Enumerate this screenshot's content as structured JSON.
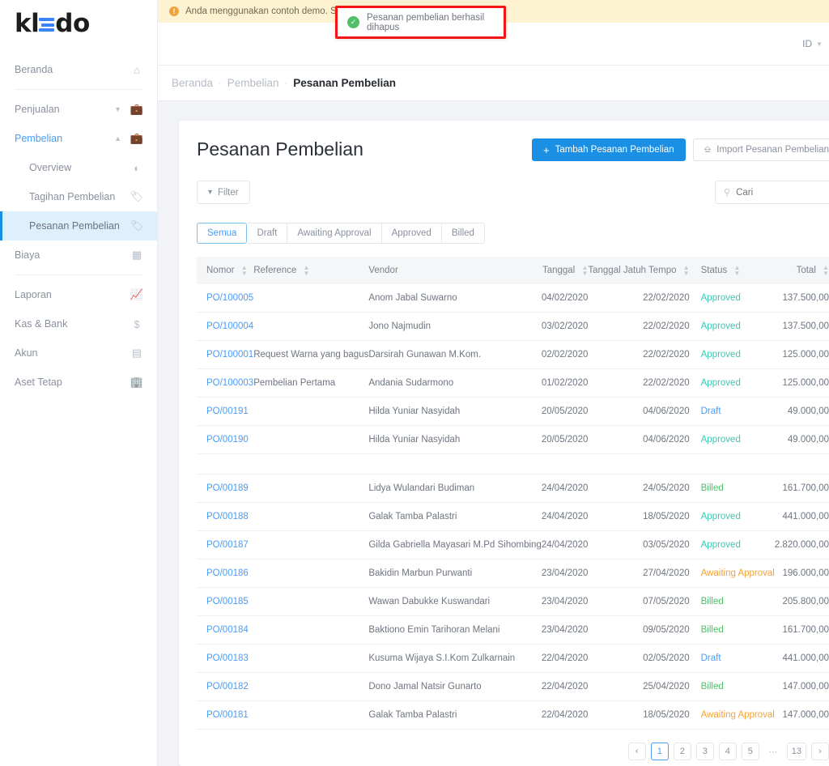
{
  "brand": {
    "name": "kledo",
    "accent": "#3b82f6"
  },
  "sidebar": {
    "items": [
      {
        "label": "Beranda",
        "icon": "home-icon"
      },
      {
        "label": "Penjualan",
        "icon": "briefcase-icon"
      },
      {
        "label": "Pembelian",
        "icon": "bag-icon"
      },
      {
        "label": "Overview",
        "icon": "pie-chart-icon"
      },
      {
        "label": "Tagihan Pembelian",
        "icon": "tag-icon"
      },
      {
        "label": "Pesanan Pembelian",
        "icon": "tag-icon"
      },
      {
        "label": "Biaya",
        "icon": "card-icon"
      },
      {
        "label": "Laporan",
        "icon": "chart-line-icon"
      },
      {
        "label": "Kas & Bank",
        "icon": "dollar-icon"
      },
      {
        "label": "Akun",
        "icon": "book-icon"
      },
      {
        "label": "Aset Tetap",
        "icon": "building-icon"
      }
    ]
  },
  "banner": {
    "text": "Anda menggunakan contoh demo. Setelah A                                        angan perusahaan Anda"
  },
  "toast": {
    "message": "Pesanan pembelian berhasil dihapus",
    "border_color": "#f51515",
    "icon_color": "#4fbf6a"
  },
  "topbar": {
    "language": "ID"
  },
  "breadcrumb": {
    "items": [
      "Beranda",
      "Pembelian",
      "Pesanan Pembelian"
    ]
  },
  "page": {
    "title": "Pesanan Pembelian"
  },
  "actions": {
    "add_label": "Tambah Pesanan Pembelian",
    "import_label": "Import Pesanan Pembelian"
  },
  "toolbar": {
    "filter_label": "Filter",
    "search_placeholder": "Cari",
    "search_value": ""
  },
  "tabs": [
    {
      "label": "Semua",
      "active": true
    },
    {
      "label": "Draft",
      "active": false
    },
    {
      "label": "Awaiting Approval",
      "active": false
    },
    {
      "label": "Approved",
      "active": false
    },
    {
      "label": "Billed",
      "active": false
    }
  ],
  "table": {
    "columns": [
      "Nomor",
      "Reference",
      "Vendor",
      "Tanggal",
      "Tanggal Jatuh Tempo",
      "Status",
      "Total"
    ],
    "rows": [
      {
        "nomor": "PO/100005",
        "reference": "",
        "vendor": "Anom Jabal Suwarno",
        "tanggal": "04/02/2020",
        "jatuh_tempo": "22/02/2020",
        "status": "Approved",
        "total": "137.500,00"
      },
      {
        "nomor": "PO/100004",
        "reference": "",
        "vendor": "Jono Najmudin",
        "tanggal": "03/02/2020",
        "jatuh_tempo": "22/02/2020",
        "status": "Approved",
        "total": "137.500,00"
      },
      {
        "nomor": "PO/100001",
        "reference": "Request Warna yang bagus",
        "vendor": "Darsirah Gunawan M.Kom.",
        "tanggal": "02/02/2020",
        "jatuh_tempo": "22/02/2020",
        "status": "Approved",
        "total": "125.000,00"
      },
      {
        "nomor": "PO/100003",
        "reference": "Pembelian Pertama",
        "vendor": "Andania Sudarmono",
        "tanggal": "01/02/2020",
        "jatuh_tempo": "22/02/2020",
        "status": "Approved",
        "total": "125.000,00"
      },
      {
        "nomor": "PO/00191",
        "reference": "",
        "vendor": "Hilda Yuniar Nasyidah",
        "tanggal": "20/05/2020",
        "jatuh_tempo": "04/06/2020",
        "status": "Draft",
        "total": "49.000,00"
      },
      {
        "nomor": "PO/00190",
        "reference": "",
        "vendor": "Hilda Yuniar Nasyidah",
        "tanggal": "20/05/2020",
        "jatuh_tempo": "04/06/2020",
        "status": "Approved",
        "total": "49.000,00"
      },
      {
        "empty": true
      },
      {
        "nomor": "PO/00189",
        "reference": "",
        "vendor": "Lidya Wulandari Budiman",
        "tanggal": "24/04/2020",
        "jatuh_tempo": "24/05/2020",
        "status": "Billed",
        "total": "161.700,00"
      },
      {
        "nomor": "PO/00188",
        "reference": "",
        "vendor": "Galak Tamba Palastri",
        "tanggal": "24/04/2020",
        "jatuh_tempo": "18/05/2020",
        "status": "Approved",
        "total": "441.000,00"
      },
      {
        "nomor": "PO/00187",
        "reference": "",
        "vendor": "Gilda Gabriella Mayasari M.Pd Sihombing",
        "tanggal": "24/04/2020",
        "jatuh_tempo": "03/05/2020",
        "status": "Approved",
        "total": "2.820.000,00"
      },
      {
        "nomor": "PO/00186",
        "reference": "",
        "vendor": "Bakidin Marbun Purwanti",
        "tanggal": "23/04/2020",
        "jatuh_tempo": "27/04/2020",
        "status": "Awaiting Approval",
        "total": "196.000,00"
      },
      {
        "nomor": "PO/00185",
        "reference": "",
        "vendor": "Wawan Dabukke Kuswandari",
        "tanggal": "23/04/2020",
        "jatuh_tempo": "07/05/2020",
        "status": "Billed",
        "total": "205.800,00"
      },
      {
        "nomor": "PO/00184",
        "reference": "",
        "vendor": "Baktiono Emin Tarihoran Melani",
        "tanggal": "23/04/2020",
        "jatuh_tempo": "09/05/2020",
        "status": "Billed",
        "total": "161.700,00"
      },
      {
        "nomor": "PO/00183",
        "reference": "",
        "vendor": "Kusuma Wijaya S.I.Kom Zulkarnain",
        "tanggal": "22/04/2020",
        "jatuh_tempo": "02/05/2020",
        "status": "Draft",
        "total": "441.000,00"
      },
      {
        "nomor": "PO/00182",
        "reference": "",
        "vendor": "Dono Jamal Natsir Gunarto",
        "tanggal": "22/04/2020",
        "jatuh_tempo": "25/04/2020",
        "status": "Billed",
        "total": "147.000,00"
      },
      {
        "nomor": "PO/00181",
        "reference": "",
        "vendor": "Galak Tamba Palastri",
        "tanggal": "22/04/2020",
        "jatuh_tempo": "18/05/2020",
        "status": "Awaiting Approval",
        "total": "147.000,00"
      }
    ]
  },
  "pagination": {
    "prev": "‹",
    "next": "›",
    "dots": "⋯",
    "pages": [
      "1",
      "2",
      "3",
      "4",
      "5"
    ],
    "last": "13",
    "current": "1"
  },
  "status_colors": {
    "Approved": "#3dc7b4",
    "Draft": "#4a9cf6",
    "Billed": "#4fbf6a",
    "Awaiting Approval": "#f0a33c"
  }
}
